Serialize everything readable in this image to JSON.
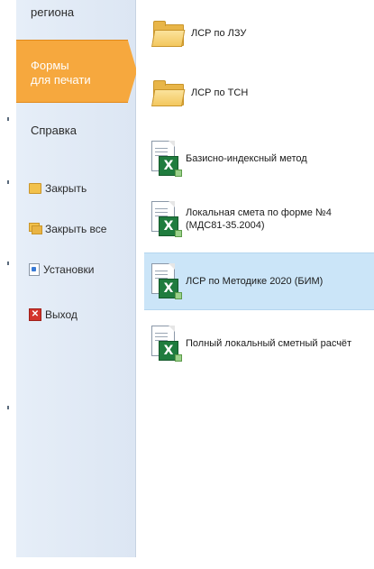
{
  "sidebar": {
    "top_item": "региона",
    "active_item": "Формы\nдля печати",
    "help_item": "Справка",
    "commands": [
      {
        "label": "Закрыть",
        "icon": "folder-icon"
      },
      {
        "label": "Закрыть все",
        "icon": "folders-icon"
      },
      {
        "label": "Установки",
        "icon": "settings-icon"
      },
      {
        "label": "Выход",
        "icon": "exit-icon"
      }
    ]
  },
  "main": {
    "items": [
      {
        "label": "ЛСР по ЛЗУ",
        "type": "folder",
        "selected": false
      },
      {
        "label": "ЛСР по ТСН",
        "type": "folder",
        "selected": false
      },
      {
        "label": "Базисно-индексный метод",
        "type": "excel-doc",
        "selected": false
      },
      {
        "label_line1": "Локальная смета по форме №4",
        "label_line2": "(МДС81-35.2004)",
        "type": "excel-doc",
        "selected": false
      },
      {
        "label": "ЛСР по Методике 2020 (БИМ)",
        "type": "excel-doc",
        "selected": true
      },
      {
        "label": "Полный локальный сметный расчёт",
        "type": "excel-doc",
        "selected": false
      }
    ]
  },
  "colors": {
    "accent_active": "#f6a83e",
    "sidebar_bg": "#dce6f3",
    "selected_bg": "#cbe5f8",
    "excel_green": "#1f7c3e"
  }
}
